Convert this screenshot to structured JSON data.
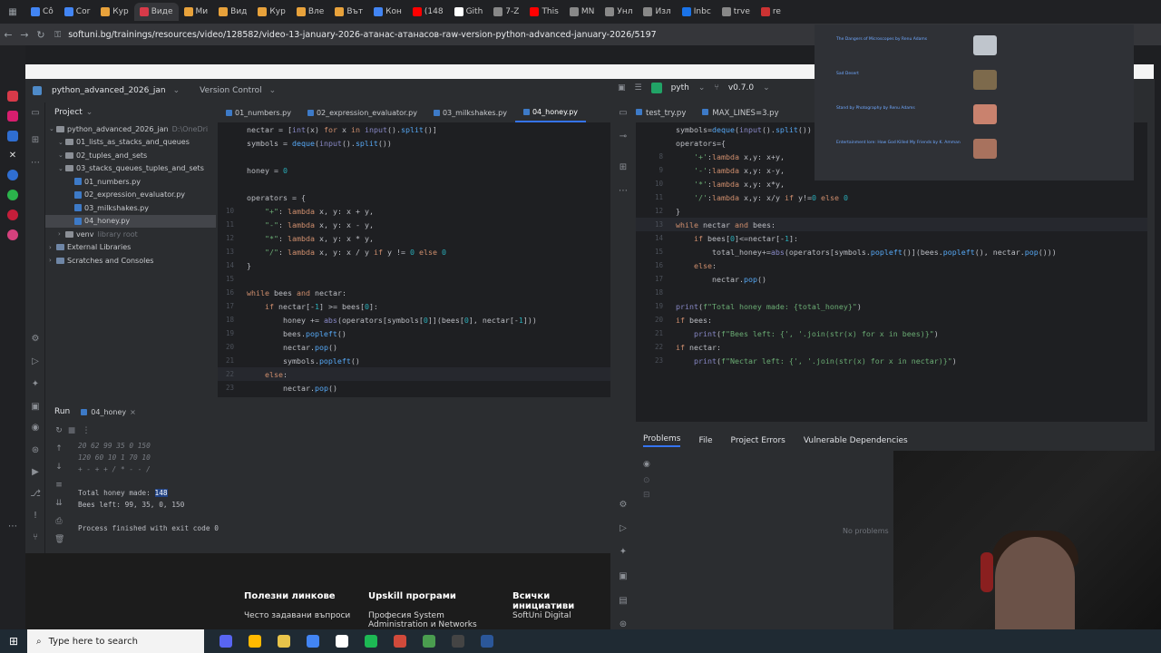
{
  "browser": {
    "tabs": [
      {
        "label": "Со̂",
        "color": "#4285f4"
      },
      {
        "label": "Cor",
        "color": "#4285f4"
      },
      {
        "label": "Кур",
        "color": "#e8a23b"
      },
      {
        "label": "Виде",
        "color": "#d73a49",
        "active": true
      },
      {
        "label": "Ми",
        "color": "#e8a23b"
      },
      {
        "label": "Вид",
        "color": "#e8a23b"
      },
      {
        "label": "Кур",
        "color": "#e8a23b"
      },
      {
        "label": "Вле",
        "color": "#e8a23b"
      },
      {
        "label": "Вът",
        "color": "#e8a23b"
      },
      {
        "label": "Кон",
        "color": "#4285f4"
      },
      {
        "label": "(148",
        "color": "#ff0000"
      },
      {
        "label": "Gith",
        "color": "#ffffff"
      },
      {
        "label": "7-Z",
        "color": "#888888"
      },
      {
        "label": "This",
        "color": "#ff0000"
      },
      {
        "label": "MN",
        "color": "#888888"
      },
      {
        "label": "Унл",
        "color": "#888888"
      },
      {
        "label": "Изл",
        "color": "#888888"
      },
      {
        "label": "Inbc",
        "color": "#1a73e8"
      },
      {
        "label": "trve",
        "color": "#888888"
      },
      {
        "label": "re",
        "color": "#cc3333"
      }
    ],
    "url": "softuni.bg/trainings/resources/video/128582/video-13-january-2026-атанас-атанасов-raw-version-python-advanced-january-2026/5197"
  },
  "ide_left": {
    "project_name": "python_advanced_2026_jan",
    "version_control": "Version Control",
    "project_label": "Project",
    "tree": [
      {
        "label": "python_advanced_2026_jan",
        "extra": "D:\\OneDri",
        "kind": "folder",
        "indent": 0
      },
      {
        "label": "01_lists_as_stacks_and_queues",
        "kind": "folder",
        "indent": 1
      },
      {
        "label": "02_tuples_and_sets",
        "kind": "folder",
        "indent": 1
      },
      {
        "label": "03_stacks_queues_tuples_and_sets",
        "kind": "folder",
        "indent": 1
      },
      {
        "label": "01_numbers.py",
        "kind": "py",
        "indent": 2
      },
      {
        "label": "02_expression_evaluator.py",
        "kind": "py",
        "indent": 2
      },
      {
        "label": "03_milkshakes.py",
        "kind": "py",
        "indent": 2
      },
      {
        "label": "04_honey.py",
        "kind": "py",
        "indent": 2,
        "selected": true
      },
      {
        "label": "venv",
        "extra": "library root",
        "kind": "folder",
        "indent": 1
      },
      {
        "label": "External Libraries",
        "kind": "lib",
        "indent": 0
      },
      {
        "label": "Scratches and Consoles",
        "kind": "lib",
        "indent": 0
      }
    ],
    "editor_tabs": [
      {
        "label": "01_numbers.py"
      },
      {
        "label": "02_expression_evaluator.py"
      },
      {
        "label": "03_milkshakes.py"
      },
      {
        "label": "04_honey.py",
        "active": true
      }
    ],
    "code": [
      {
        "n": "",
        "t": "nectar = [int(x) for x in input().split()]"
      },
      {
        "n": "",
        "t": "symbols = deque(input().split())"
      },
      {
        "n": "",
        "t": ""
      },
      {
        "n": "",
        "t": "honey = 0"
      },
      {
        "n": "",
        "t": ""
      },
      {
        "n": "",
        "t": "operators = {"
      },
      {
        "n": "10",
        "t": "    \"+\": lambda x, y: x + y,"
      },
      {
        "n": "11",
        "t": "    \"-\": lambda x, y: x - y,"
      },
      {
        "n": "12",
        "t": "    \"*\": lambda x, y: x * y,"
      },
      {
        "n": "13",
        "t": "    \"/\": lambda x, y: x / y if y != 0 else 0"
      },
      {
        "n": "14",
        "t": "}"
      },
      {
        "n": "15",
        "t": ""
      },
      {
        "n": "16",
        "t": "while bees and nectar:"
      },
      {
        "n": "17",
        "t": "    if nectar[-1] >= bees[0]:"
      },
      {
        "n": "18",
        "t": "        honey += abs(operators[symbols[0]](bees[0], nectar[-1]))"
      },
      {
        "n": "19",
        "t": "        bees.popleft()"
      },
      {
        "n": "20",
        "t": "        nectar.pop()"
      },
      {
        "n": "21",
        "t": "        symbols.popleft()"
      },
      {
        "n": "22",
        "t": "    else:"
      },
      {
        "n": "23",
        "t": "        nectar.pop()"
      }
    ],
    "run": {
      "label": "Run",
      "tab": "04_honey",
      "output": [
        {
          "text": "20 62 99 35 0 150",
          "faint": true
        },
        {
          "text": "120 60 10 1 70 10",
          "faint": true
        },
        {
          "text": "+ - + + / * - - /",
          "faint": true
        },
        {
          "text": ""
        },
        {
          "text": "Total honey made: ",
          "value": "148"
        },
        {
          "text": "Bees left: 99, 35, 0, 150"
        },
        {
          "text": ""
        },
        {
          "text": "Process finished with exit code 0"
        }
      ]
    }
  },
  "webfoot": {
    "cols": [
      {
        "title": "Полезни линкове",
        "sub": "Често задавани въпроси"
      },
      {
        "title": "Upskill програми",
        "sub": "Професия System Administration и Networks"
      },
      {
        "title": "Всички инициативи",
        "sub": "SoftUni Digital"
      }
    ]
  },
  "ide_right": {
    "project": "pyth",
    "version": "v0.7.0",
    "tabs": [
      "test_try.py",
      "MAX_LINES=3.py"
    ],
    "code": [
      {
        "n": "",
        "t": "symbols=deque(input().split())"
      },
      {
        "n": "",
        "t": "operators={"
      },
      {
        "n": "8",
        "t": "    '+':lambda x,y: x+y,"
      },
      {
        "n": "9",
        "t": "    '-':lambda x,y: x-y,"
      },
      {
        "n": "10",
        "t": "    '*':lambda x,y: x*y,"
      },
      {
        "n": "11",
        "t": "    '/':lambda x,y: x/y if y!=0 else 0"
      },
      {
        "n": "12",
        "t": "}"
      },
      {
        "n": "13",
        "t": "while nectar and bees:"
      },
      {
        "n": "14",
        "t": "    if bees[0]<=nectar[-1]:"
      },
      {
        "n": "15",
        "t": "        total_honey+=abs(operators[symbols.popleft()](bees.popleft(), nectar.pop()))"
      },
      {
        "n": "16",
        "t": "    else:"
      },
      {
        "n": "17",
        "t": "        nectar.pop()"
      },
      {
        "n": "18",
        "t": ""
      },
      {
        "n": "19",
        "t": "print(f\"Total honey made: {total_honey}\")"
      },
      {
        "n": "20",
        "t": "if bees:"
      },
      {
        "n": "21",
        "t": "    print(f\"Bees left: {', '.join(str(x) for x in bees)}\")"
      },
      {
        "n": "22",
        "t": "if nectar:"
      },
      {
        "n": "23",
        "t": "    print(f\"Nectar left: {', '.join(str(x) for x in nectar)}\")"
      }
    ],
    "problem_tabs": [
      "Problems",
      "File",
      "Project Errors",
      "Vulnerable Dependencies"
    ],
    "no_problems": "No problems"
  },
  "overlay": {
    "items": [
      {
        "title": "The Dangers of Microscopes by Renu Adams",
        "thumb": "#bfc5cc"
      },
      {
        "title": "Sad Desert",
        "thumb": "#7d6a4c"
      },
      {
        "title": "Stand by Photography by Renu Adams",
        "thumb": "#c9826e"
      },
      {
        "title": "Entertainment lore: How God Killed My Friends by K. Amman",
        "thumb": "#a8725e"
      }
    ]
  },
  "taskbar": {
    "search_placeholder": "Type here to search",
    "apps": [
      "#5865f2",
      "#ffb900",
      "#e8c44a",
      "#4285f4",
      "#ffffff",
      "#1db954",
      "#d04a3b",
      "#4a9d4f",
      "#444444",
      "#2b579a"
    ]
  }
}
